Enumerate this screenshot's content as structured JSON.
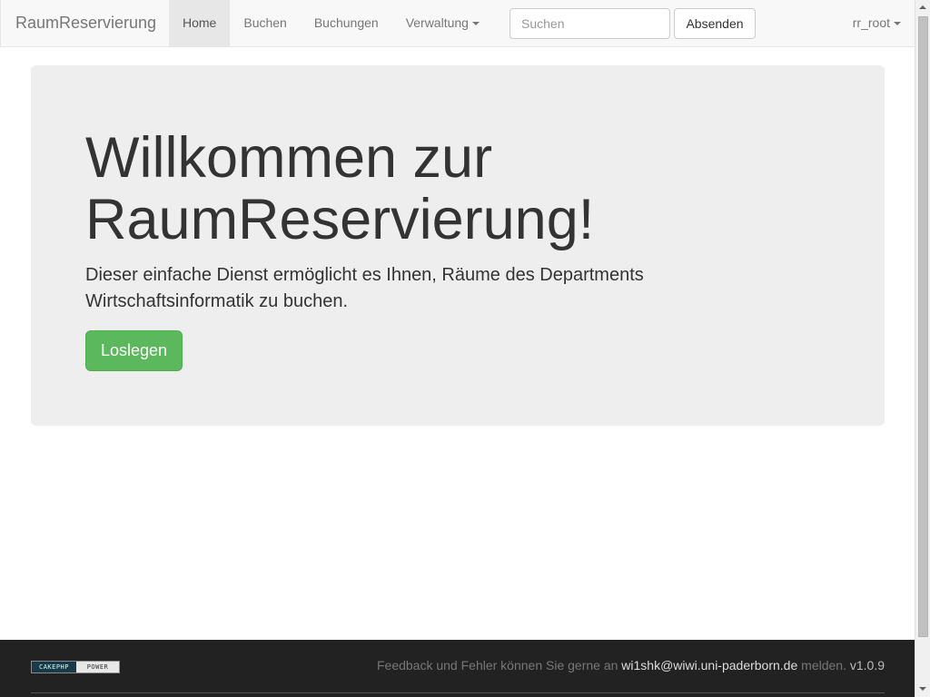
{
  "navbar": {
    "brand": "RaumReservierung",
    "items": [
      {
        "label": "Home",
        "active": true
      },
      {
        "label": "Buchen"
      },
      {
        "label": "Buchungen"
      },
      {
        "label": "Verwaltung",
        "dropdown": true
      }
    ],
    "search": {
      "placeholder": "Suchen",
      "value": "",
      "button_label": "Absenden"
    },
    "user": {
      "label": "rr_root",
      "dropdown": true
    }
  },
  "jumbotron": {
    "title": "Willkommen zur RaumReservierung!",
    "text": "Dieser einfache Dienst ermöglicht es Ihnen, Räume des Departments Wirtschaftsinformatik zu buchen.",
    "button_label": "Loslegen",
    "button_color": "#5cb85c"
  },
  "footer": {
    "badge_left": "CAKEPHP",
    "badge_right": "POWER",
    "text_before": "Feedback und Fehler können Sie gerne an",
    "email": "wi1shk@wiwi.uni-paderborn.de",
    "text_after": "melden.",
    "version": "v1.0.9"
  },
  "icons": {
    "dropdown": "caret-down-icon"
  }
}
